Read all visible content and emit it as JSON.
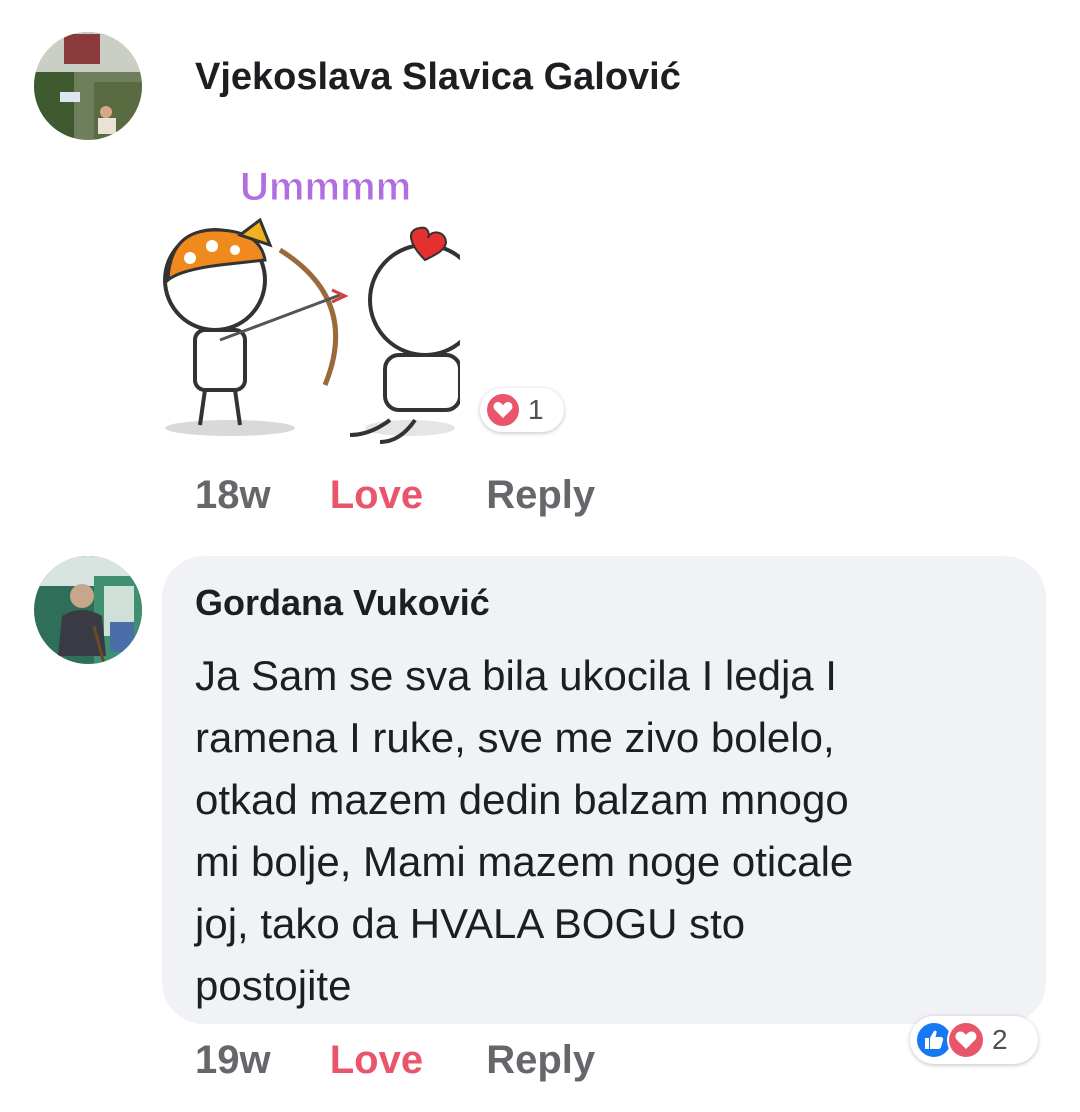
{
  "comments": [
    {
      "author": "Vjekoslava Slavica Galović",
      "sticker_text": "Ummmm",
      "reactions": {
        "icons": [
          "love-icon"
        ],
        "count": "1"
      },
      "time": "18w",
      "love_label": "Love",
      "reply_label": "Reply"
    },
    {
      "author": "Gordana Vuković",
      "text_lines": [
        "Ja Sam se sva bila ukocila I ledja I",
        "ramena I ruke, sve me zivo bolelo,",
        "otkad mazem dedin balzam mnogo",
        "mi bolje, Mami mazem noge oticale",
        "joj, tako da HVALA BOGU sto",
        "postojite"
      ],
      "reactions": {
        "icons": [
          "like-icon",
          "love-icon"
        ],
        "count": "2"
      },
      "time": "19w",
      "love_label": "Love",
      "reply_label": "Reply"
    }
  ],
  "colors": {
    "love": "#e9566b",
    "like": "#1877f2",
    "bubble_bg": "#f0f2f5",
    "meta_gray": "#65676b"
  }
}
